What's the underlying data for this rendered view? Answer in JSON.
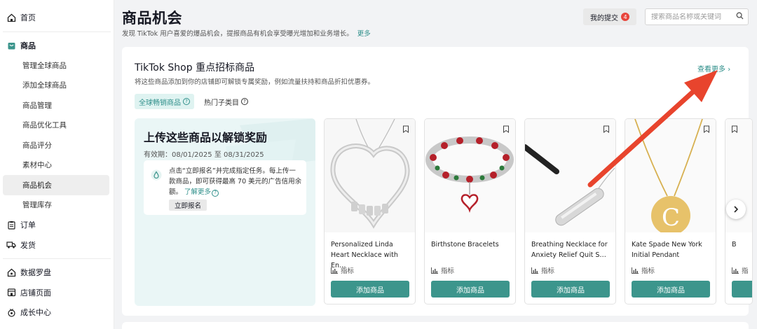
{
  "sidebar": {
    "home": "首页",
    "product_section": "商品",
    "product_items": [
      "管理全球商品",
      "添加全球商品",
      "商品管理",
      "商品优化工具",
      "商品评分",
      "素材中心",
      "商品机会",
      "管理库存"
    ],
    "active_item": "商品机会",
    "orders": "订单",
    "shipping": "发货",
    "data_compass": "数据罗盘",
    "store_page": "店铺页面",
    "growth_center": "成长中心"
  },
  "header": {
    "title": "商品机会",
    "subtitle": "发现 TikTok 用户喜爱的爆品机会，提报商品有机会享受曝光增加和业务增长。",
    "more_link": "更多",
    "my_submissions": "我的提交",
    "submissions_count": "4",
    "search_placeholder": "搜索商品名称或关键词"
  },
  "section": {
    "title": "TikTok Shop 重点招标商品",
    "description": "将这些商品添加到你的店铺即可解锁专属奖励，例如流量扶持和商品折扣优惠券。",
    "view_more": "查看更多",
    "chips": [
      "全球畅销商品",
      "热门子类目"
    ]
  },
  "promo": {
    "title": "上传这些商品以解锁奖励",
    "validity": "有效期：08/01/2025 至 08/31/2025",
    "text": "点击“立即报名”并完成指定任务。每上传一款商品，即可获得最高 70 美元的广告信用余额。",
    "learn_more": "了解更多",
    "enroll_button": "立即报名"
  },
  "products": [
    {
      "name": "Personalized Linda Heart Necklace with En…",
      "metric": "指标",
      "button": "添加商品"
    },
    {
      "name": "Birthstone Bracelets",
      "metric": "指标",
      "button": "添加商品"
    },
    {
      "name": "Breathing Necklace for Anxiety Relief Quit S…",
      "metric": "指标",
      "button": "添加商品"
    },
    {
      "name": "Kate Spade New York Initial Pendant",
      "metric": "指标",
      "button": "添加商品"
    },
    {
      "name": "B",
      "metric": "指",
      "button": ""
    }
  ],
  "colors": {
    "accent": "#3c958c",
    "link": "#2f8f8a",
    "badge": "#e8453c",
    "annotation_arrow": "#e8442d"
  }
}
